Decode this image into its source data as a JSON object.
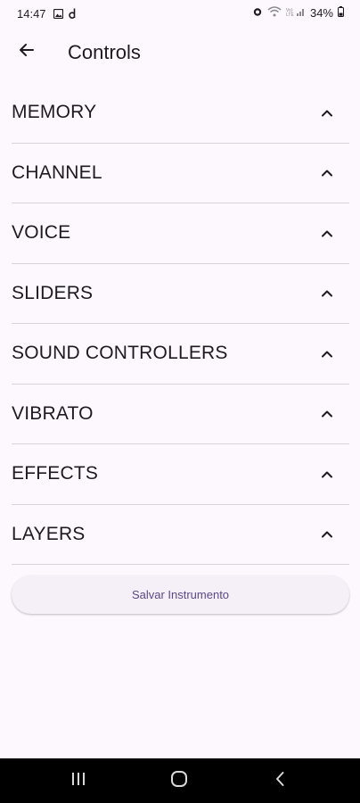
{
  "status_bar": {
    "time": "14:47",
    "battery_text": "34%",
    "left_icons": [
      "gallery-icon",
      "d-icon"
    ],
    "right_icons": [
      "alarm-icon",
      "wifi-icon",
      "signal-icon",
      "battery-icon"
    ]
  },
  "app_bar": {
    "title": "Controls",
    "back_icon": "arrow-left-icon"
  },
  "sections": [
    {
      "label": "MEMORY",
      "icon": "chevron-up-icon"
    },
    {
      "label": "CHANNEL",
      "icon": "chevron-up-icon"
    },
    {
      "label": "VOICE",
      "icon": "chevron-up-icon"
    },
    {
      "label": "SLIDERS",
      "icon": "chevron-up-icon"
    },
    {
      "label": "SOUND CONTROLLERS",
      "icon": "chevron-up-icon"
    },
    {
      "label": "VIBRATO",
      "icon": "chevron-up-icon"
    },
    {
      "label": "EFFECTS",
      "icon": "chevron-up-icon"
    },
    {
      "label": "LAYERS",
      "icon": "chevron-up-icon"
    }
  ],
  "save_button": {
    "label": "Salvar Instrumento"
  },
  "nav_bar": {
    "icons": [
      "recent-apps-icon",
      "home-icon",
      "back-icon"
    ]
  },
  "colors": {
    "background": "#fdf8fd",
    "button_background": "#f5eff7",
    "button_text": "#5a4a8a",
    "divider": "#d6d3d9",
    "nav_background": "#000000"
  }
}
